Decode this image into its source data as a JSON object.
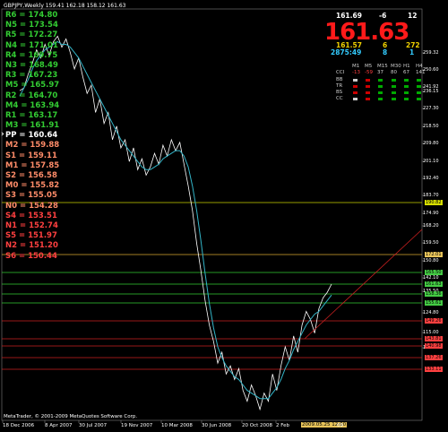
{
  "title": "GBPJPY,Weekly  159.41 162.18 158.12 161.63",
  "pivots": [
    {
      "label": "R6 = 174.80",
      "color": "#33cc33"
    },
    {
      "label": "N5 = 173.54",
      "color": "#33cc33"
    },
    {
      "label": "R5 = 172.27",
      "color": "#33cc33"
    },
    {
      "label": "N4 = 171.01",
      "color": "#33cc33"
    },
    {
      "label": "R4 = 169.75",
      "color": "#33cc33"
    },
    {
      "label": "N3 = 168.49",
      "color": "#33cc33"
    },
    {
      "label": "R3 = 167.23",
      "color": "#33cc33"
    },
    {
      "label": "M5 = 165.97",
      "color": "#33cc33"
    },
    {
      "label": "R2 = 164.70",
      "color": "#33cc33"
    },
    {
      "label": "M4 = 163.94",
      "color": "#33cc33"
    },
    {
      "label": "R1 = 163.17",
      "color": "#33cc33"
    },
    {
      "label": "M3 = 161.91",
      "color": "#33cc33"
    },
    {
      "label": "PP = 160.64",
      "color": "#ffffff"
    },
    {
      "label": "M2 = 159.88",
      "color": "#ff8c69"
    },
    {
      "label": "S1 = 159.11",
      "color": "#ff8c69"
    },
    {
      "label": "M1 = 157.85",
      "color": "#ff8c69"
    },
    {
      "label": "S2 = 156.58",
      "color": "#ff8c69"
    },
    {
      "label": "M0 = 155.82",
      "color": "#ff8c69"
    },
    {
      "label": "S3 = 155.05",
      "color": "#ff8c69"
    },
    {
      "label": "N0 = 154.28",
      "color": "#ff8c69"
    },
    {
      "label": "S4 = 153.51",
      "color": "#ff4040"
    },
    {
      "label": "N1 = 152.74",
      "color": "#ff4040"
    },
    {
      "label": "S5 = 151.97",
      "color": "#ff4040"
    },
    {
      "label": "N2 = 151.20",
      "color": "#ff4040"
    },
    {
      "label": "S6 = 150.44",
      "color": "#ff4040"
    }
  ],
  "panel": {
    "high_price": "161.69",
    "change": "-6",
    "spread": "12",
    "big_price": "161.63",
    "low_price": "161.57",
    "v2": "6",
    "v3": "272",
    "time": "2875:49",
    "v4": "8",
    "v5": "1"
  },
  "indicators": {
    "timeframes": [
      "M1",
      "M5",
      "M15",
      "M30",
      "H1",
      "H4"
    ],
    "cci_label": "CCI",
    "cci_values": [
      "-13",
      "-59",
      "37",
      "80",
      "67",
      "141"
    ],
    "rows": [
      {
        "label": "BB",
        "colors": [
          "#cccccc",
          "#cc0000",
          "#00aa00",
          "#00aa00",
          "#00aa00",
          "#00aa00"
        ]
      },
      {
        "label": "TR",
        "colors": [
          "#cc0000",
          "#cc0000",
          "#00aa00",
          "#00aa00",
          "#00aa00",
          "#00aa00"
        ]
      },
      {
        "label": "BS",
        "colors": [
          "#cc0000",
          "#cc0000",
          "#00aa00",
          "#00aa00",
          "#00aa00",
          "#00aa00"
        ]
      },
      {
        "label": "CC",
        "colors": [
          "#cccccc",
          "#cc0000",
          "#00aa00",
          "#00aa00",
          "#00aa00",
          "#00aa00"
        ]
      }
    ]
  },
  "y_axis": {
    "ticks": [
      "259.32",
      "250.60",
      "241.92",
      "236.15",
      "227.30",
      "218.50",
      "209.80",
      "201.10",
      "192.40",
      "183.70",
      "174.90",
      "168.20",
      "159.50",
      "150.80",
      "142.10",
      "135.50",
      "124.80",
      "115.00",
      "107.30"
    ],
    "tags": [
      {
        "label": "190.82",
        "bg": "#d8e000"
      },
      {
        "label": "172.01",
        "bg": "#e8c45a"
      },
      {
        "label": "165.50",
        "bg": "#44cc44"
      },
      {
        "label": "161.63",
        "bg": "#44cc44"
      },
      {
        "label": "158.36",
        "bg": "#44cc44"
      },
      {
        "label": "155.61",
        "bg": "#44cc44"
      },
      {
        "label": "149.26",
        "bg": "#ff4040"
      },
      {
        "label": "143.81",
        "bg": "#ff4040"
      },
      {
        "label": "140.98",
        "bg": "#ff4040"
      },
      {
        "label": "137.26",
        "bg": "#ff4040"
      },
      {
        "label": "133.11",
        "bg": "#ff4040"
      }
    ]
  },
  "x_axis": {
    "ticks": [
      "18 Dec 2006",
      "8 Apr 2007",
      "30 Jul 2007",
      "19 Nov 2007",
      "10 Mar 2008",
      "30 Jun 2008",
      "20 Oct 2008",
      "2 Feb"
    ],
    "current": "2009.05.25 12:00",
    "end": "09"
  },
  "copyright": "MetaTrader, © 2001-2009 MetaQuotes Software Corp.",
  "chart_data": {
    "type": "line",
    "title": "GBPJPY,Weekly  159.41 162.18 158.12 161.63",
    "series": [
      {
        "values": [
          232,
          233,
          238,
          242,
          247,
          244,
          249,
          245,
          250,
          252,
          248,
          251,
          246,
          240,
          244,
          237,
          231,
          234,
          224,
          229,
          220,
          224,
          214,
          219,
          211,
          214,
          206,
          211,
          203,
          207,
          201,
          204,
          209,
          205,
          212,
          208,
          214,
          210,
          213,
          205,
          197,
          188,
          176,
          166,
          155,
          146,
          140,
          132,
          136,
          128,
          131,
          126,
          130,
          122,
          118,
          124,
          120,
          115,
          121,
          118,
          128,
          122,
          131,
          138,
          133,
          142,
          136,
          146,
          151,
          148,
          143,
          152,
          156,
          158,
          161
        ]
      },
      {
        "values": [
          230,
          233,
          236,
          240,
          243,
          245,
          247,
          248,
          249,
          250,
          249,
          249,
          248,
          246,
          244,
          241,
          238,
          235,
          232,
          229,
          226,
          223,
          220,
          217,
          214,
          212,
          210,
          208,
          206,
          204,
          203,
          203,
          204,
          205,
          207,
          208,
          209,
          210,
          210,
          208,
          204,
          197,
          188,
          177,
          165,
          154,
          145,
          138,
          134,
          131,
          129,
          127,
          126,
          124,
          122,
          121,
          120,
          119,
          119,
          119,
          121,
          123,
          126,
          130,
          133,
          137,
          140,
          143,
          146,
          148,
          150,
          151,
          153,
          155,
          157
        ]
      }
    ],
    "ylim": [
      111,
      262
    ]
  }
}
